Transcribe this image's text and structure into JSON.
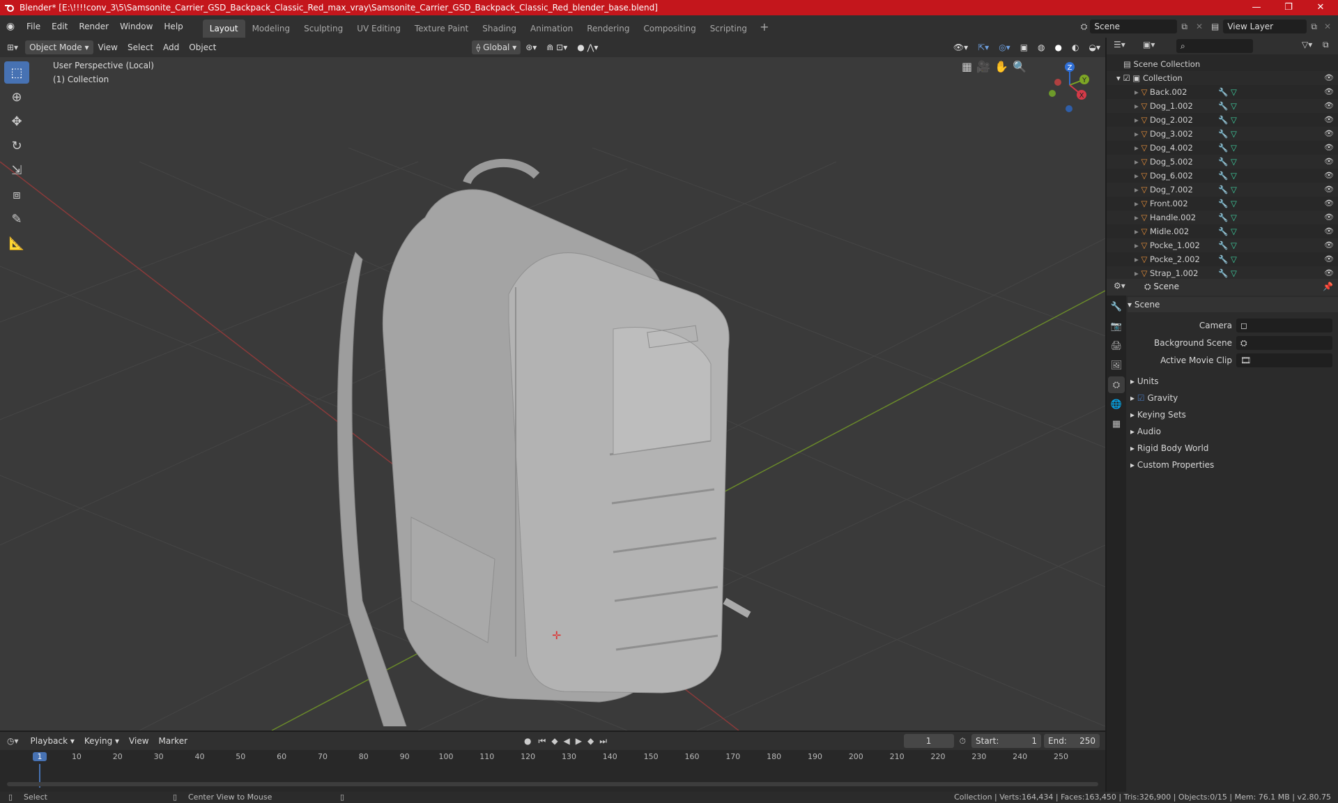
{
  "window": {
    "title": "Blender* [E:\\!!!!conv_3\\5\\Samsonite_Carrier_GSD_Backpack_Classic_Red_max_vray\\Samsonite_Carrier_GSD_Backpack_Classic_Red_blender_base.blend]",
    "minimize": "—",
    "maximize": "❐",
    "close": "✕",
    "accent": "#c4161c"
  },
  "menu": [
    "File",
    "Edit",
    "Render",
    "Window",
    "Help"
  ],
  "workspaces": [
    "Layout",
    "Modeling",
    "Sculpting",
    "UV Editing",
    "Texture Paint",
    "Shading",
    "Animation",
    "Rendering",
    "Compositing",
    "Scripting"
  ],
  "scene_field": "Scene",
  "view_layer_field": "View Layer",
  "viewport_header": {
    "mode": "Object Mode",
    "menus": [
      "View",
      "Select",
      "Add",
      "Object"
    ],
    "transform": "Global"
  },
  "viewport": {
    "perspective": "User Perspective (Local)",
    "collection": "(1) Collection",
    "gizmo": {
      "z": "Z",
      "y": "Y",
      "x": "X"
    }
  },
  "outliner": {
    "root": "Scene Collection",
    "collection": "Collection",
    "items": [
      "Back.002",
      "Dog_1.002",
      "Dog_2.002",
      "Dog_3.002",
      "Dog_4.002",
      "Dog_5.002",
      "Dog_6.002",
      "Dog_7.002",
      "Front.002",
      "Handle.002",
      "Midle.002",
      "Pocke_1.002",
      "Pocke_2.002",
      "Strap_1.002"
    ]
  },
  "properties": {
    "breadcrumb": "Scene",
    "panel": "Scene",
    "camera_label": "Camera",
    "bg_scene_label": "Background Scene",
    "movie_clip_label": "Active Movie Clip",
    "sections": [
      "Units",
      "Gravity",
      "Keying Sets",
      "Audio",
      "Rigid Body World",
      "Custom Properties"
    ]
  },
  "timeline": {
    "menus": [
      "Playback",
      "Keying",
      "View",
      "Marker"
    ],
    "current_frame": "1",
    "start_label": "Start:",
    "start": "1",
    "end_label": "End:",
    "end": "250",
    "ticks": [
      "1",
      "10",
      "20",
      "30",
      "40",
      "50",
      "60",
      "70",
      "80",
      "90",
      "100",
      "110",
      "120",
      "130",
      "140",
      "150",
      "160",
      "170",
      "180",
      "190",
      "200",
      "210",
      "220",
      "230",
      "240",
      "250"
    ]
  },
  "status": {
    "left": "Select",
    "middle": "Center View to Mouse",
    "right": "Collection | Verts:164,434 | Faces:163,450 | Tris:326,900 | Objects:0/15 | Mem: 76.1 MB | v2.80.75"
  }
}
